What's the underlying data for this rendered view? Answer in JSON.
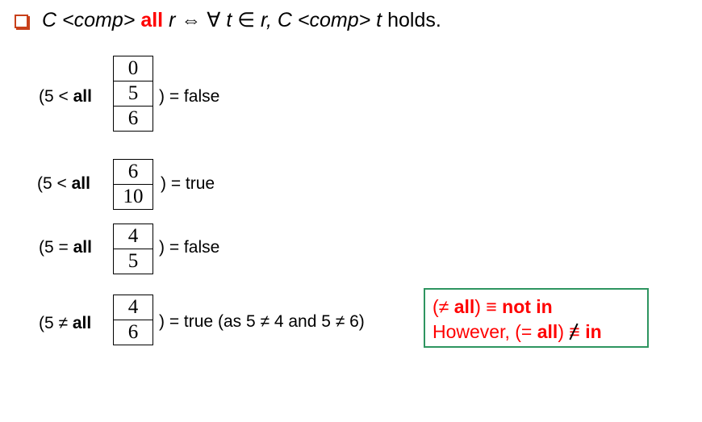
{
  "heading": {
    "c": "C",
    "comp": "<comp>",
    "all": "all",
    "r": "r",
    "iff": "⇔",
    "forall": "∀",
    "t": "t",
    "in": "∈",
    "r2": "r,",
    "c2": "C",
    "comp2": "<comp>",
    "t2": "t",
    "holds": "holds."
  },
  "examples": [
    {
      "prefix": "(5 < ",
      "all": "all",
      "values": [
        "0",
        "5",
        "6"
      ],
      "suffix": ") = false"
    },
    {
      "prefix": "(5 < ",
      "all": "all",
      "values": [
        "6",
        "10"
      ],
      "suffix": ") = true"
    },
    {
      "prefix": "(5 = ",
      "all": "all",
      "values": [
        "4",
        "5"
      ],
      "suffix": ") = false"
    },
    {
      "prefix": "(5 ≠ ",
      "all": "all",
      "values": [
        "4",
        "6"
      ],
      "suffix": ") = true (as 5 ≠ 4 and 5 ≠ 6)"
    }
  ],
  "note": {
    "l1a": "(≠ ",
    "l1b": "all",
    "l1c": ") ≡ ",
    "l1d": "not in",
    "l2a": "However, (= ",
    "l2b": "all",
    "l2c": ") ",
    "l2d": "≡",
    "l2e": " in"
  }
}
